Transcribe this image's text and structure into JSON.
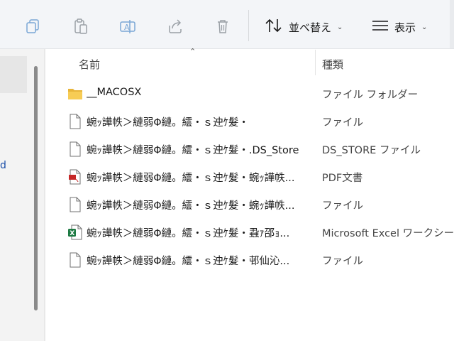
{
  "toolbar": {
    "sort_label": "並べ替え",
    "view_label": "表示",
    "icons": [
      "copy-icon",
      "paste-icon",
      "rename-icon",
      "share-icon",
      "delete-icon",
      "sort-icon",
      "view-icon"
    ]
  },
  "nav": {
    "partial_label": "d"
  },
  "columns": {
    "name": "名前",
    "type": "種類"
  },
  "files": [
    {
      "name": "__MACOSX",
      "type": "ファイル フォルダー",
      "icon": "folder-icon"
    },
    {
      "name": "蜿ｯ譁帙＞縺弱Φ縺。繧・ｓ迚ｹ髮・",
      "type": "ファイル",
      "icon": "file-icon"
    },
    {
      "name": "蜿ｯ譁帙＞縺弱Φ縺。繧・ｓ迚ｹ髮・.DS_Store",
      "type": "DS_STORE ファイル",
      "icon": "file-icon"
    },
    {
      "name": "蜿ｯ譁帙＞縺弱Φ縺。繧・ｓ迚ｹ髮・蜿ｯ譁帙...",
      "type": "PDF文書",
      "icon": "pdf-icon"
    },
    {
      "name": "蜿ｯ譁帙＞縺弱Φ縺。繧・ｓ迚ｹ髮・蜿ｯ譁帙...",
      "type": "ファイル",
      "icon": "file-icon"
    },
    {
      "name": "蜿ｯ譁帙＞縺弱Φ縺。繧・ｓ迚ｹ髮・蝨ｧ邵ｮ...",
      "type": "Microsoft Excel ワークシート",
      "icon": "excel-icon"
    },
    {
      "name": "蜿ｯ譁帙＞縺弱Φ縺。繧・ｓ迚ｹ髮・邨仙沁...",
      "type": "ファイル",
      "icon": "file-icon"
    }
  ]
}
